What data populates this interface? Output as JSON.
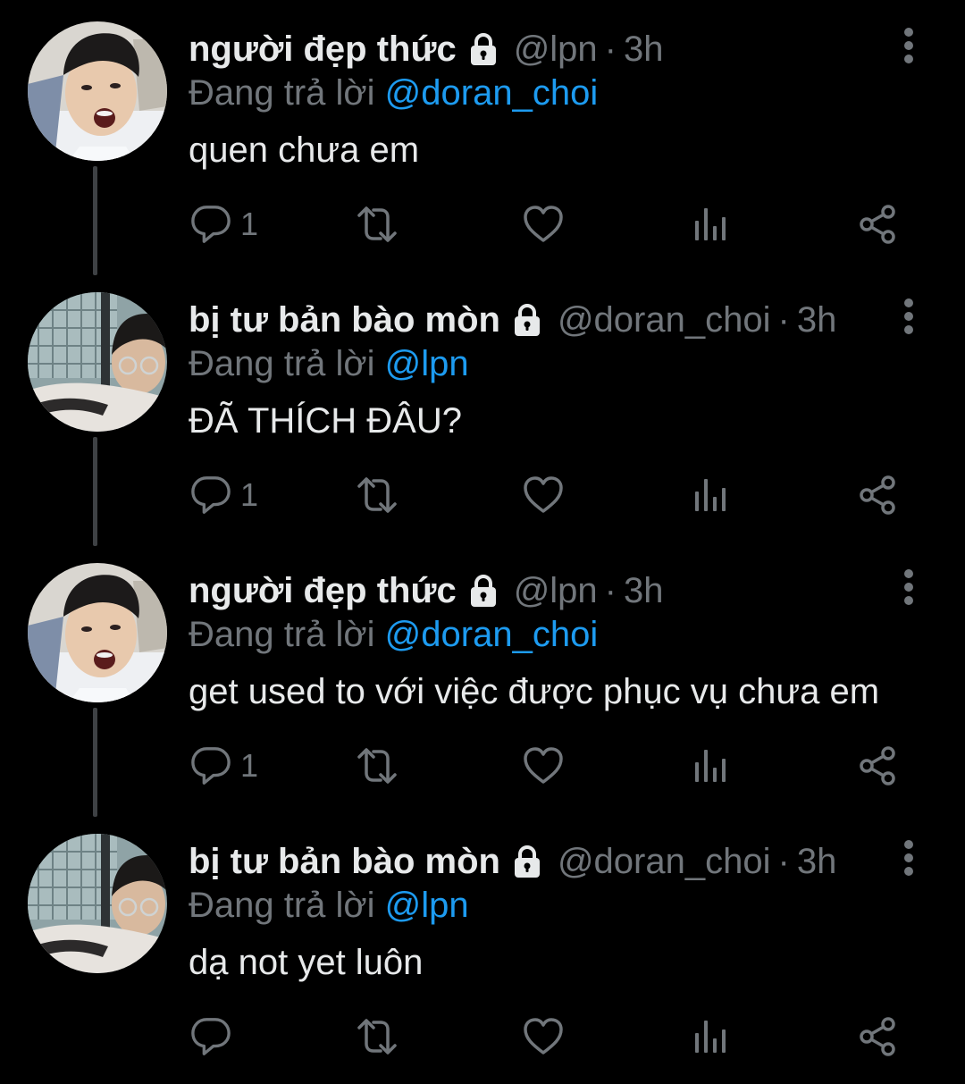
{
  "colors": {
    "background": "#000000",
    "primary_text": "#e7e9ea",
    "secondary_text": "#71767b",
    "mention": "#1d9bf0",
    "thread_line": "#3e4144"
  },
  "tweets": [
    {
      "display_name": "người đẹp thức",
      "handle": "@lpn",
      "dot": "·",
      "time": "3h",
      "replying_prefix": "Đang trả lời",
      "replying_to": "@doran_choi",
      "text": "quen chưa em",
      "reply_count": "1",
      "avatar": "avatar-a",
      "protected_icon": "lock-icon"
    },
    {
      "display_name": "bị tư bản bào mòn",
      "handle": "@doran_choi",
      "dot": "·",
      "time": "3h",
      "replying_prefix": "Đang trả lời",
      "replying_to": "@lpn",
      "text": "ĐÃ THÍCH ĐÂU?",
      "reply_count": "1",
      "avatar": "avatar-b",
      "protected_icon": "lock-icon"
    },
    {
      "display_name": "người đẹp thức",
      "handle": "@lpn",
      "dot": "·",
      "time": "3h",
      "replying_prefix": "Đang trả lời",
      "replying_to": "@doran_choi",
      "text": "get used to với việc được phục vụ chưa em",
      "reply_count": "1",
      "avatar": "avatar-a",
      "protected_icon": "lock-icon"
    },
    {
      "display_name": "bị tư bản bào mòn",
      "handle": "@doran_choi",
      "dot": "·",
      "time": "3h",
      "replying_prefix": "Đang trả lời",
      "replying_to": "@lpn",
      "text": "dạ not yet luôn",
      "reply_count": "",
      "avatar": "avatar-b",
      "protected_icon": "lock-icon"
    }
  ],
  "icons": {
    "more": "more-vertical-icon",
    "reply": "reply-icon",
    "retweet": "retweet-icon",
    "like": "heart-icon",
    "views": "views-icon",
    "share": "share-icon"
  }
}
